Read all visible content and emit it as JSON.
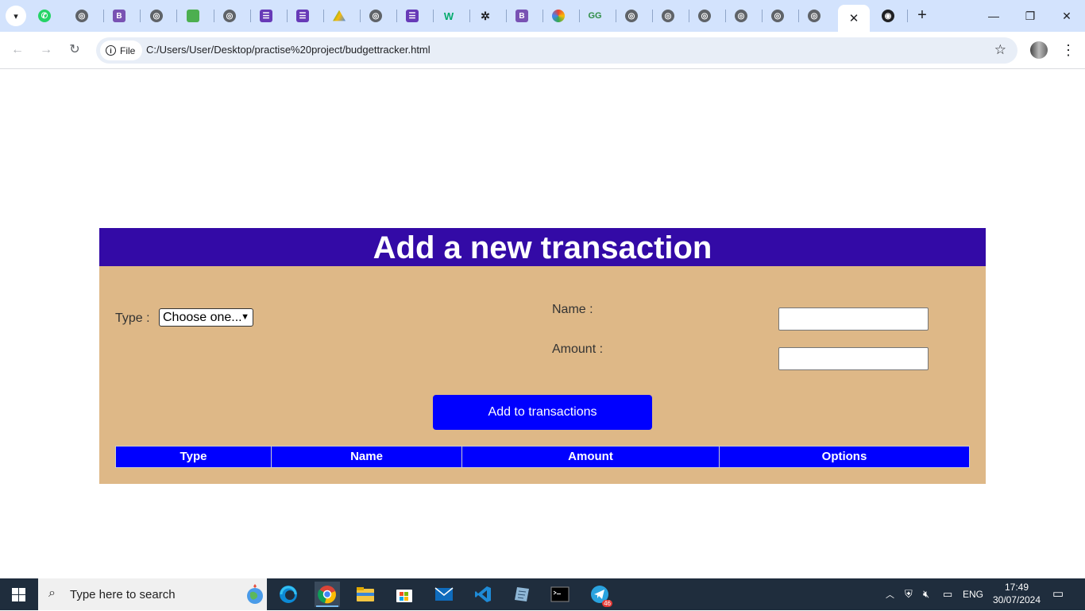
{
  "browser": {
    "address": {
      "chip_label": "File",
      "url": "C:/Users/User/Desktop/practise%20project/budgettracker.html"
    },
    "active_tab_close": "✕"
  },
  "page": {
    "heading": "Add a new transaction",
    "type_label": "Type :",
    "type_select_value": "Choose one...",
    "name_label": "Name :",
    "name_value": "",
    "amount_label": "Amount :",
    "amount_value": "",
    "add_button": "Add to transactions",
    "table": {
      "headers": [
        "Type",
        "Name",
        "Amount",
        "Options"
      ]
    }
  },
  "taskbar": {
    "search_placeholder": "Type here to search",
    "telegram_badge": "46",
    "tray": {
      "language": "ENG",
      "time": "17:49",
      "date": "30/07/2024"
    }
  }
}
